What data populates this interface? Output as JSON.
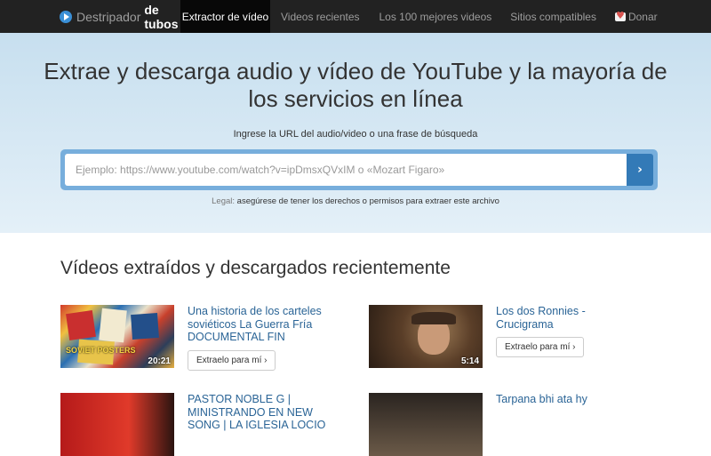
{
  "nav": {
    "brand_light": "Destripador",
    "brand_bold": "de tubos",
    "items": [
      {
        "label": "Extractor de vídeo"
      },
      {
        "label": "Videos recientes"
      },
      {
        "label": "Los 100 mejores videos"
      },
      {
        "label": "Sitios compatibles"
      },
      {
        "label": "Donar"
      }
    ]
  },
  "hero": {
    "title": "Extrae y descarga audio y vídeo de YouTube y la mayoría de los servicios en línea",
    "input_label": "Ingrese la URL del audio/video o una frase de búsqueda",
    "search_placeholder": "Ejemplo: https://www.youtube.com/watch?v=ipDmsxQVxIM o «Mozart Figaro»",
    "search_button": "›",
    "legal_key": "Legal:",
    "legal_text": "asegúrese de tener los derechos o permisos para extraer este archivo"
  },
  "recent": {
    "title": "Vídeos extraídos y descargados recientemente",
    "extract_label": "Extraelo para mí ›",
    "videos": [
      {
        "title": "Una historia de los carteles soviéticos La Guerra Fría DOCUMENTAL FIN",
        "duration": "20:21",
        "thumb_text": "SOVIET POSTERS"
      },
      {
        "title": "Los dos Ronnies - Crucigrama",
        "duration": "5:14"
      },
      {
        "title": "PASTOR NOBLE G | MINISTRANDO EN NEW SONG | LA IGLESIA LOCIO",
        "duration": ""
      },
      {
        "title": "Tarpana bhi ata hy",
        "duration": ""
      }
    ]
  },
  "colors": {
    "navbar": "#222222",
    "hero_top": "#c7dfef",
    "search_frame": "#77aedc",
    "search_button": "#337ab7",
    "link": "#2a6496"
  }
}
